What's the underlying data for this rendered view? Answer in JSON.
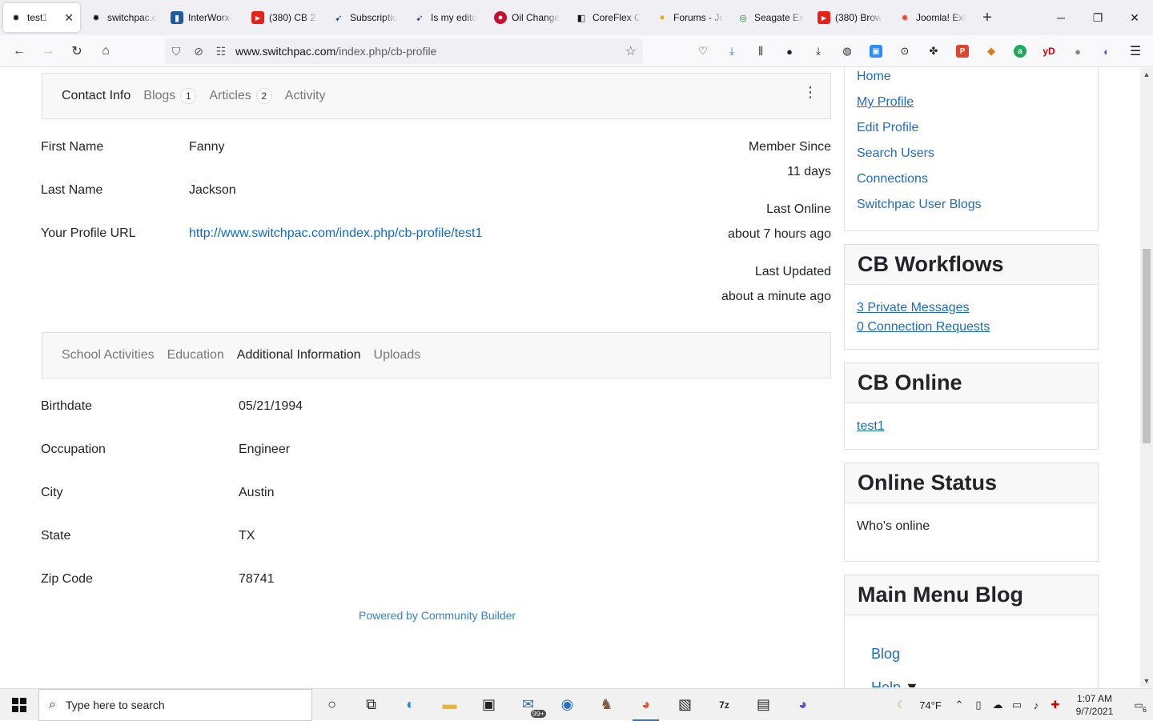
{
  "browser": {
    "tabs": [
      {
        "label": "test1",
        "icon": "joomla-icon",
        "active": true
      },
      {
        "label": "switchpac.c",
        "icon": "joomla-icon"
      },
      {
        "label": "InterWorx-",
        "icon": "interworx-icon"
      },
      {
        "label": "(380) CB 2.",
        "icon": "youtube-icon"
      },
      {
        "label": "Subscriptio",
        "icon": "bird-icon"
      },
      {
        "label": "Is my edito",
        "icon": "bird-icon"
      },
      {
        "label": "Oil Change",
        "icon": "oil-icon"
      },
      {
        "label": "CoreFlex C",
        "icon": "coreflex-icon"
      },
      {
        "label": "Forums - Jc",
        "icon": "forum-icon"
      },
      {
        "label": "Seagate Ex",
        "icon": "seagate-icon"
      },
      {
        "label": "(380) Brow",
        "icon": "youtube-icon"
      },
      {
        "label": "Joomla! Ext",
        "icon": "joomla-icon"
      }
    ],
    "url_host": "www.switchpac.com",
    "url_path": "/index.php/cb-profile"
  },
  "profile": {
    "tabs1": [
      {
        "label": "Contact Info",
        "badge": null,
        "active": true
      },
      {
        "label": "Blogs",
        "badge": "1"
      },
      {
        "label": "Articles",
        "badge": "2"
      },
      {
        "label": "Activity",
        "badge": null
      }
    ],
    "fields1": [
      {
        "label": "First Name",
        "value": "Fanny"
      },
      {
        "label": "Last Name",
        "value": "Jackson"
      },
      {
        "label": "Your Profile URL",
        "value": "http://www.switchpac.com/index.php/cb-profile/test1"
      }
    ],
    "stats": [
      {
        "label": "Member Since",
        "value": "11 days"
      },
      {
        "label": "Last Online",
        "value": "about 7 hours ago"
      },
      {
        "label": "Last Updated",
        "value": "about a minute ago"
      }
    ],
    "tabs2": [
      {
        "label": "School Activities"
      },
      {
        "label": "Education"
      },
      {
        "label": "Additional Information",
        "active": true
      },
      {
        "label": "Uploads"
      }
    ],
    "fields2": [
      {
        "label": "Birthdate",
        "value": "05/21/1994"
      },
      {
        "label": "Occupation",
        "value": "Engineer"
      },
      {
        "label": "City",
        "value": "Austin"
      },
      {
        "label": "State",
        "value": "TX"
      },
      {
        "label": "Zip Code",
        "value": "78741"
      }
    ],
    "powered": "Powered by Community Builder"
  },
  "sidebar": {
    "menu": [
      "Home",
      "My Profile",
      "Edit Profile",
      "Search Users",
      "Connections",
      "Switchpac User Blogs"
    ],
    "workflows_title": "CB Workflows",
    "workflows": [
      "3 Private Messages",
      "0 Connection Requests"
    ],
    "online_title": "CB Online",
    "online_user": "test1",
    "status_title": "Online Status",
    "status_text": "Who's online",
    "blog_title": "Main Menu Blog",
    "blog_links": [
      "Blog",
      "Help"
    ]
  },
  "taskbar": {
    "search_placeholder": "Type here to search",
    "mail_badge": "99+",
    "weather": "74°F",
    "time": "1:07 AM",
    "date": "9/7/2021",
    "notifications": "6"
  }
}
